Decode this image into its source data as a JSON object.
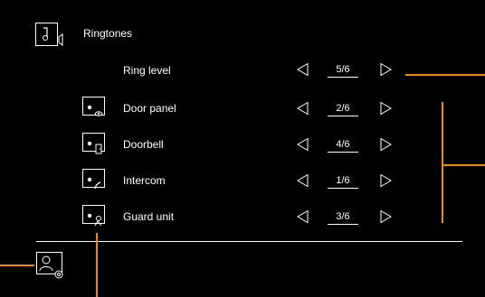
{
  "header": {
    "title": "Ringtones",
    "title_icon": "music-note-speaker-icon"
  },
  "ring_level": {
    "label": "Ring level",
    "value": "5/6"
  },
  "items": [
    {
      "label": "Door panel",
      "icon": "door-panel-eye-icon",
      "value": "2/6"
    },
    {
      "label": "Doorbell",
      "icon": "doorbell-door-icon",
      "value": "4/6"
    },
    {
      "label": "Intercom",
      "icon": "intercom-handset-icon",
      "value": "1/6"
    },
    {
      "label": "Guard unit",
      "icon": "guard-unit-person-icon",
      "value": "3/6"
    }
  ],
  "footer": {
    "settings_icon": "user-settings-icon"
  },
  "colors": {
    "background": "#000000",
    "foreground": "#ffffff",
    "callout": "#f08a00"
  }
}
